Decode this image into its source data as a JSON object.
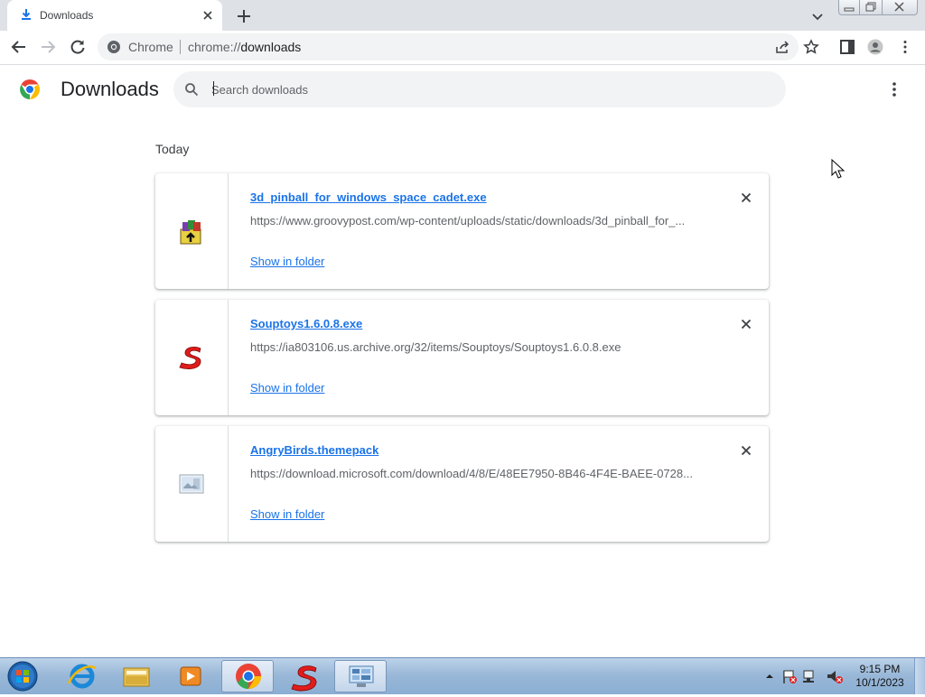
{
  "browser": {
    "tab": {
      "title": "Downloads",
      "icon": "download-icon"
    },
    "address": {
      "chip": "Chrome",
      "scheme": "chrome://",
      "path": "downloads"
    },
    "accent_color": "#1a73e8"
  },
  "page": {
    "title": "Downloads",
    "search_placeholder": "Search downloads",
    "section_label": "Today"
  },
  "downloads": [
    {
      "filename": "3d_pinball_for_windows_space_cadet.exe",
      "url": "https://www.groovypost.com/wp-content/uploads/static/downloads/3d_pinball_for_...",
      "action": "Show in folder",
      "icon": "winrar-installer-icon"
    },
    {
      "filename": "Souptoys1.6.0.8.exe",
      "url": "https://ia803106.us.archive.org/32/items/Souptoys/Souptoys1.6.0.8.exe",
      "action": "Show in folder",
      "icon": "souptoys-icon"
    },
    {
      "filename": "AngryBirds.themepack",
      "url": "https://download.microsoft.com/download/4/8/E/48EE7950-8B46-4F4E-BAEE-0728...",
      "action": "Show in folder",
      "icon": "themepack-file-icon"
    }
  ],
  "taskbar": {
    "items": [
      "start-orb-icon",
      "internet-explorer-icon",
      "file-explorer-icon",
      "media-player-icon",
      "chrome-icon",
      "souptoys-icon",
      "control-panel-icon"
    ],
    "time": "9:15 PM",
    "date": "10/1/2023"
  }
}
